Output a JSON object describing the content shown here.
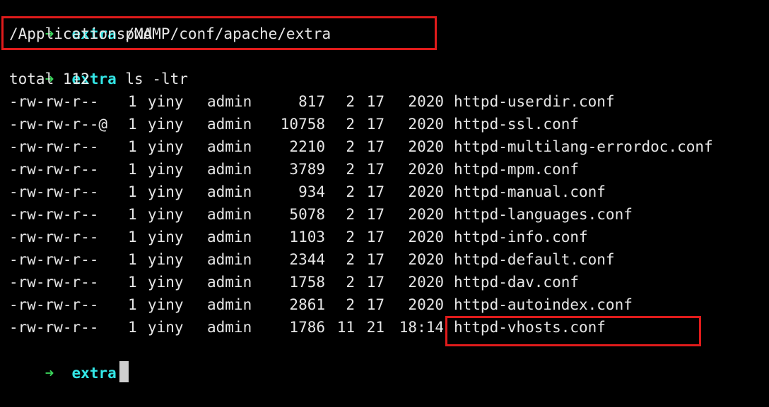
{
  "prompt": {
    "arrow": "➜",
    "dir": "extra"
  },
  "commands": {
    "pwd": "pwd",
    "ls": "ls -ltr"
  },
  "pwd_output": "/Applications/MAMP/conf/apache/extra",
  "total_line": "total 112",
  "files": [
    {
      "perms": "-rw-rw-r--",
      "links": "1",
      "owner": "yiny",
      "group": "admin",
      "size": "817",
      "month": "2",
      "day": "17",
      "time": "2020",
      "name": "httpd-userdir.conf"
    },
    {
      "perms": "-rw-rw-r--@",
      "links": "1",
      "owner": "yiny",
      "group": "admin",
      "size": "10758",
      "month": "2",
      "day": "17",
      "time": "2020",
      "name": "httpd-ssl.conf"
    },
    {
      "perms": "-rw-rw-r--",
      "links": "1",
      "owner": "yiny",
      "group": "admin",
      "size": "2210",
      "month": "2",
      "day": "17",
      "time": "2020",
      "name": "httpd-multilang-errordoc.conf"
    },
    {
      "perms": "-rw-rw-r--",
      "links": "1",
      "owner": "yiny",
      "group": "admin",
      "size": "3789",
      "month": "2",
      "day": "17",
      "time": "2020",
      "name": "httpd-mpm.conf"
    },
    {
      "perms": "-rw-rw-r--",
      "links": "1",
      "owner": "yiny",
      "group": "admin",
      "size": "934",
      "month": "2",
      "day": "17",
      "time": "2020",
      "name": "httpd-manual.conf"
    },
    {
      "perms": "-rw-rw-r--",
      "links": "1",
      "owner": "yiny",
      "group": "admin",
      "size": "5078",
      "month": "2",
      "day": "17",
      "time": "2020",
      "name": "httpd-languages.conf"
    },
    {
      "perms": "-rw-rw-r--",
      "links": "1",
      "owner": "yiny",
      "group": "admin",
      "size": "1103",
      "month": "2",
      "day": "17",
      "time": "2020",
      "name": "httpd-info.conf"
    },
    {
      "perms": "-rw-rw-r--",
      "links": "1",
      "owner": "yiny",
      "group": "admin",
      "size": "2344",
      "month": "2",
      "day": "17",
      "time": "2020",
      "name": "httpd-default.conf"
    },
    {
      "perms": "-rw-rw-r--",
      "links": "1",
      "owner": "yiny",
      "group": "admin",
      "size": "1758",
      "month": "2",
      "day": "17",
      "time": "2020",
      "name": "httpd-dav.conf"
    },
    {
      "perms": "-rw-rw-r--",
      "links": "1",
      "owner": "yiny",
      "group": "admin",
      "size": "2861",
      "month": "2",
      "day": "17",
      "time": "2020",
      "name": "httpd-autoindex.conf"
    },
    {
      "perms": "-rw-rw-r--",
      "links": "1",
      "owner": "yiny",
      "group": "admin",
      "size": "1786",
      "month": "11",
      "day": "21",
      "time": "18:14",
      "name": "httpd-vhosts.conf"
    }
  ],
  "colors": {
    "background": "#000000",
    "text": "#e6e6e6",
    "prompt_arrow": "#3ad35a",
    "prompt_dir": "#33e6e6",
    "highlight": "#e01b1b"
  }
}
